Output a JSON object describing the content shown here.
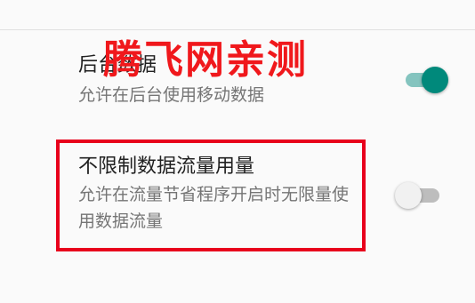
{
  "settings": {
    "background_data": {
      "title": "后台数据",
      "summary": "允许在后台使用移动数据",
      "enabled": true
    },
    "unrestricted_data": {
      "title": "不限制数据流量用量",
      "summary": "允许在流量节省程序开启时无限量使用数据流量",
      "enabled": false
    }
  },
  "watermark": {
    "text": "腾飞网亲测"
  },
  "colors": {
    "accent": "#00897b",
    "accent_track": "#84c4bf",
    "highlight": "#e8001c",
    "watermark": "#f0181c"
  },
  "icons": {
    "toggle_on": "switch-on",
    "toggle_off": "switch-off"
  }
}
